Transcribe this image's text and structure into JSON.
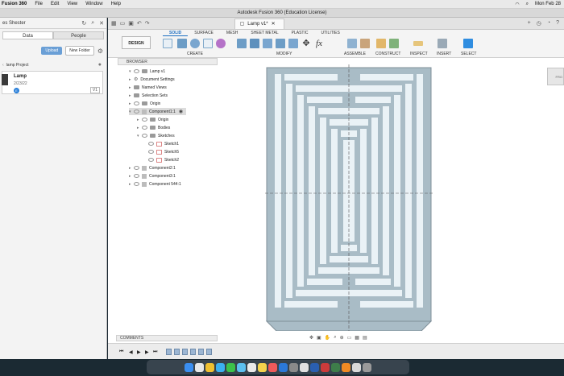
{
  "menubar": {
    "app": "Fusion 360",
    "items": [
      "File",
      "Edit",
      "View",
      "Window",
      "Help"
    ],
    "clock": "Mon Feb 28"
  },
  "window": {
    "title": "Autodesk Fusion 360 (Education License)"
  },
  "data_panel": {
    "team": "es Shester",
    "tabs": [
      "Data",
      "People"
    ],
    "upload": "Upload",
    "new_folder": "New Folder",
    "project": "lamp Project",
    "file": {
      "name": "Lamp",
      "date": "2/23/22",
      "version": "V1"
    }
  },
  "document": {
    "tab_title": "Lamp v1*"
  },
  "toolbar": {
    "design": "DESIGN",
    "workspaces": [
      "SOLID",
      "SURFACE",
      "MESH",
      "SHEET METAL",
      "PLASTIC",
      "UTILITIES"
    ],
    "groups": [
      "CREATE",
      "MODIFY",
      "ASSEMBLE",
      "CONSTRUCT",
      "INSPECT",
      "INSERT",
      "SELECT"
    ]
  },
  "browser": {
    "title": "BROWSER",
    "rows": [
      "Lamp v1",
      "Document Settings",
      "Named Views",
      "Selection Sets",
      "Origin",
      "Component1:1",
      "Origin",
      "Bodies",
      "Sketches",
      "Sketch1",
      "Sketch5",
      "Sketch2",
      "Component2:1",
      "Component3:1",
      "Component 544:1"
    ]
  },
  "comments": {
    "label": "COMMENTS"
  },
  "viewcube": {
    "label": "FRO"
  },
  "colors": {
    "accent": "#1b6ec2",
    "model_fill": "#a9bcc6",
    "model_slot": "#eaf2f6"
  }
}
